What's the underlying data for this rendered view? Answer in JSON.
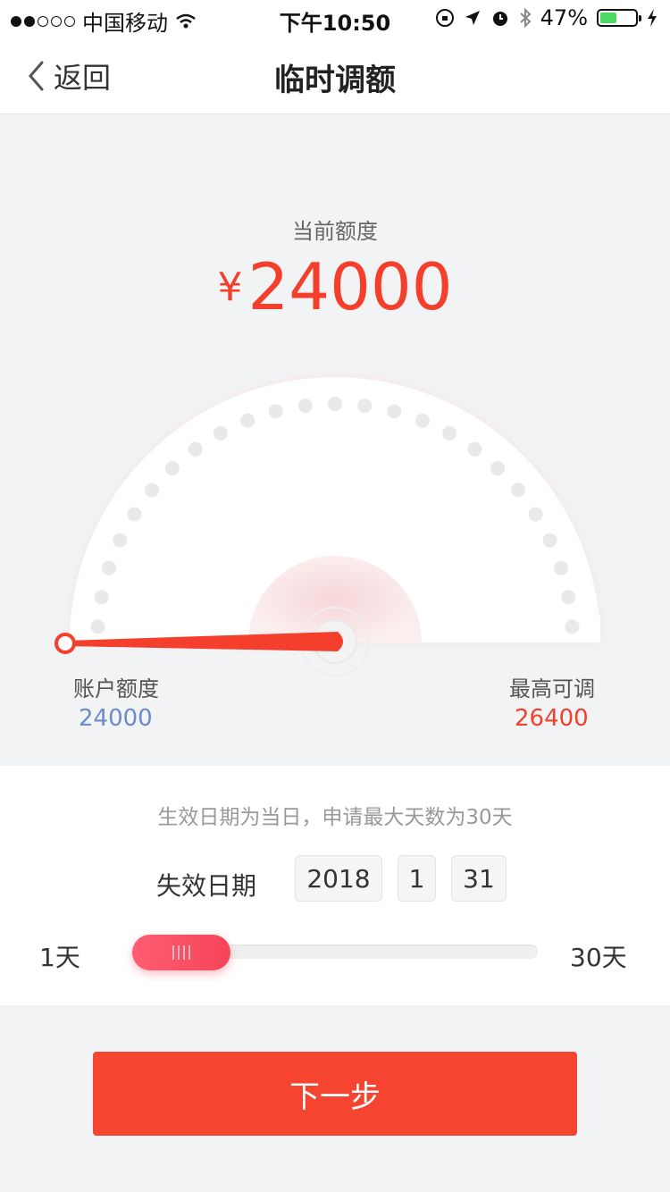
{
  "status_bar": {
    "carrier": "中国移动",
    "time": "下午10:50",
    "battery": "47%",
    "battery_level": 0.47,
    "signal_bars": 2
  },
  "nav": {
    "back_label": "返回",
    "title": "临时调额"
  },
  "quota": {
    "current_label": "当前额度",
    "currency": "¥",
    "current_value": "24000",
    "account_label": "账户额度",
    "account_value": "24000",
    "max_label": "最高可调",
    "max_value": "26400"
  },
  "form": {
    "hint": "生效日期为当日，申请最大天数为30天",
    "expire_label": "失效日期",
    "year": "2018",
    "month": "1",
    "day": "31",
    "slider_min_label": "1天",
    "slider_max_label": "30天",
    "slider_value_days": 1,
    "slider_max_days": 30
  },
  "actions": {
    "next_label": "下一步"
  },
  "colors": {
    "accent": "#f33f2b",
    "account_blue": "#6b8cc8",
    "button": "#f54430"
  }
}
